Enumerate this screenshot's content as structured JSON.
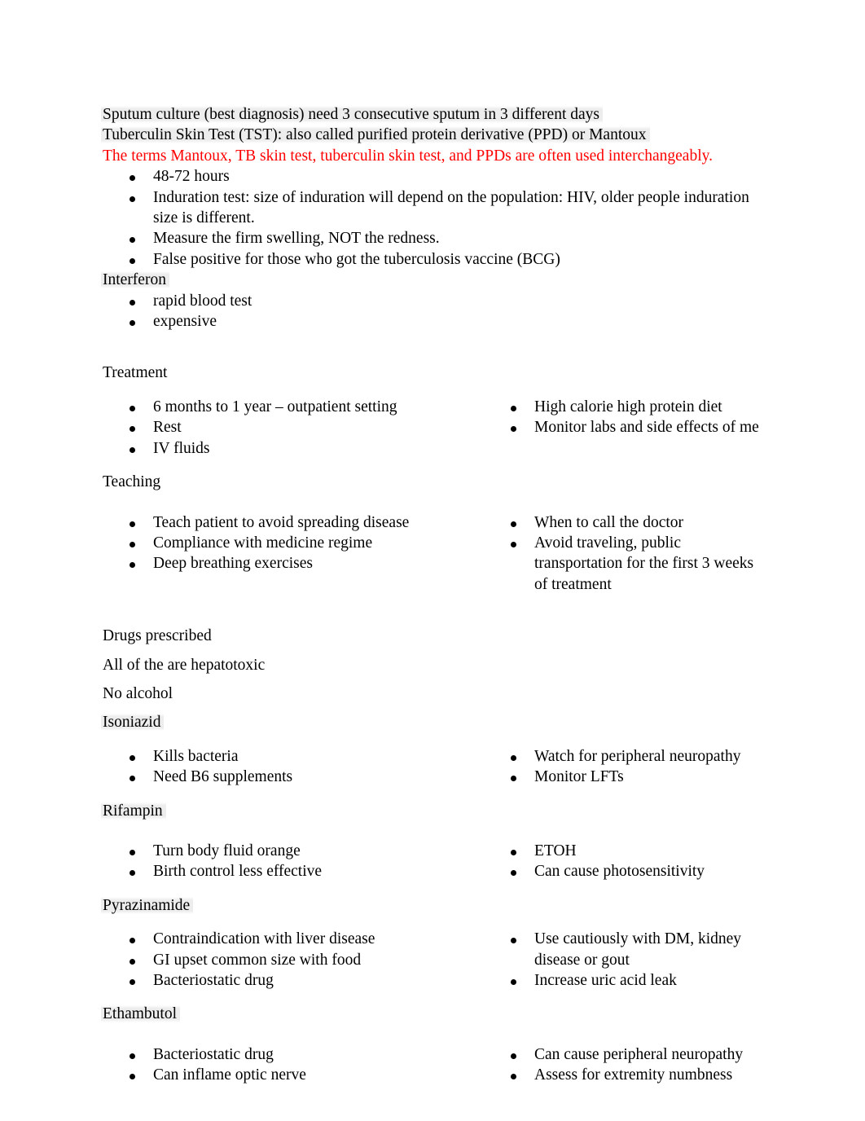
{
  "document": {
    "intro_lines": [
      {
        "text": "Sputum culture (best diagnosis) need 3 consecutive sputum in 3 different days",
        "color": "#000000",
        "highlight": true
      },
      {
        "text": "Tuberculin Skin Test (TST):  also called purified protein derivative (PPD) or Mantoux",
        "color": "#000000",
        "highlight": true
      },
      {
        "text": "The terms Mantoux, TB skin test, tuberculin skin test, and PPDs are often used interchangeably.",
        "color": "#ff0000",
        "highlight": false
      }
    ],
    "tst_bullets": [
      "48-72 hours",
      "Induration test: size of induration will depend on the population: HIV, older people induration size is different.",
      "Measure the firm swelling, NOT the redness.",
      "False positive for those who got the tuberculosis vaccine (BCG)"
    ],
    "interferon": {
      "heading": "Interferon",
      "bullets": [
        "rapid blood test",
        "expensive"
      ]
    },
    "treatment": {
      "heading": "Treatment",
      "left_bullets": [
        "6 months to 1 year – outpatient setting",
        "Rest",
        "IV fluids"
      ],
      "right_bullets": [
        "High calorie high protein diet",
        "Monitor labs and side effects of me"
      ]
    },
    "teaching": {
      "heading": "Teaching",
      "left_bullets": [
        "Teach patient to avoid spreading disease",
        "Compliance with medicine regime",
        "Deep breathing exercises"
      ],
      "right_bullets": [
        "When to call the doctor",
        "Avoid traveling, public transportation for the first 3 weeks of treatment"
      ]
    },
    "drugs_intro": [
      "Drugs prescribed",
      "All of the are hepatotoxic",
      "No alcohol"
    ],
    "drugs": [
      {
        "name": "Isoniazid",
        "highlight": true,
        "left_bullets": [
          "Kills bacteria",
          "Need B6 supplements"
        ],
        "right_bullets": [
          "Watch for peripheral neuropathy",
          "Monitor LFTs"
        ]
      },
      {
        "name": "Rifampin",
        "highlight": true,
        "left_bullets": [
          "Turn body fluid orange",
          "Birth control less effective"
        ],
        "right_bullets": [
          "ETOH",
          "Can cause photosensitivity"
        ]
      },
      {
        "name": "Pyrazinamide",
        "highlight": true,
        "left_bullets": [
          "Contraindication with liver disease",
          "GI upset common size with food",
          "Bacteriostatic drug"
        ],
        "right_bullets": [
          "Use cautiously with DM, kidney disease or gout",
          "Increase uric acid leak"
        ]
      },
      {
        "name": "Ethambutol",
        "highlight": true,
        "left_bullets": [
          "Bacteriostatic drug",
          "Can inflame optic nerve"
        ],
        "right_bullets": [
          "Can cause peripheral neuropathy",
          "Assess for extremity numbness"
        ]
      }
    ],
    "colors": {
      "text": "#000000",
      "accent_red": "#ff0000",
      "highlight_grey": "#ececec",
      "page_background": "#ffffff"
    }
  }
}
